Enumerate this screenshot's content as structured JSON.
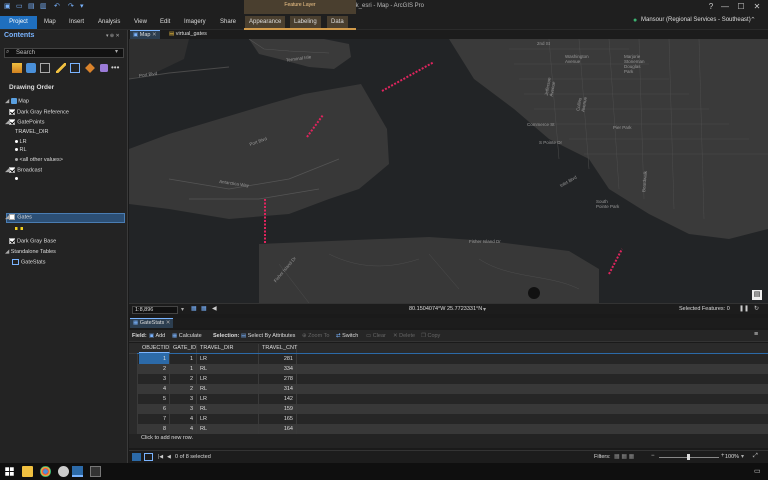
{
  "window": {
    "title": "spark_esri - Map - ArcGIS Pro",
    "help": "?",
    "minimize": "—",
    "maximize": "☐",
    "close": "✕"
  },
  "ribbon": {
    "tabs": [
      "Project",
      "Map",
      "Insert",
      "Analysis",
      "View",
      "Edit",
      "Imagery",
      "Share",
      "Appearance",
      "Labeling",
      "Data"
    ],
    "contextual_label": "Feature Layer",
    "user": "Mansour (Regional Services - Southeast)"
  },
  "contents": {
    "title": "Contents",
    "pin": "▾ ⊕ ✕",
    "search_placeholder": "Search",
    "drawing_order": "Drawing Order",
    "map": "Map",
    "dark_gray_reference": "Dark Gray Reference",
    "gate_points": "GatePoints",
    "travel_dir": "TRAVEL_DIR",
    "lr": "LR",
    "rl": "RL",
    "all_other": "<all other values>",
    "broadcast": "Broadcast",
    "gates": "Gates",
    "dark_gray_base": "Dark Gray Base",
    "standalone_tables": "Standalone Tables",
    "gatestats": "GateStats"
  },
  "map_tabs": {
    "map": "Map",
    "virtual_gates": "virtual_gates"
  },
  "map_labels": {
    "terminal_isle": "Terminal Isle",
    "port_blvd": "Port Blvd",
    "port_blvd2": "Port Blvd",
    "antarctica_way": "Antarctica Way",
    "second_st": "2nd St",
    "washington": "Washington\nAvenue",
    "jefferson": "Jefferson\nAvenue",
    "collins": "Collins\nAvenue",
    "commerce": "Commerce St",
    "s_pointe": "S Pointe Dr",
    "pier_park": "Pier Park",
    "south_pointe_park": "South\nPointe Park",
    "fisher_island": "Fisher Island Dr",
    "marjorie": "Marjorie\nStoneman\nDouglas\nPark",
    "inlet_blvd": "Inlet Blvd",
    "fisher_island_dr": "Fisher Island Dr",
    "boardwalk": "Boardwalk"
  },
  "map_status": {
    "scale": "1:8,896",
    "coords": "80.1504074°W 25.7723331°N",
    "selected": "Selected Features: 0"
  },
  "table": {
    "tab": "GateStats",
    "field_label": "Field:",
    "add": "Add",
    "calculate": "Calculate",
    "selection_label": "Selection:",
    "select_by_attr": "Select By Attributes",
    "zoom_to": "Zoom To",
    "switch": "Switch",
    "clear": "Clear",
    "delete": "Delete",
    "copy": "Copy",
    "columns": [
      "OBJECTID",
      "GATE_ID",
      "TRAVEL_DIR",
      "TRAVEL_CNT"
    ],
    "rows": [
      [
        "1",
        "1",
        "LR",
        "281"
      ],
      [
        "2",
        "1",
        "RL",
        "334"
      ],
      [
        "3",
        "2",
        "LR",
        "278"
      ],
      [
        "4",
        "2",
        "RL",
        "314"
      ],
      [
        "5",
        "3",
        "LR",
        "142"
      ],
      [
        "6",
        "3",
        "RL",
        "159"
      ],
      [
        "7",
        "4",
        "LR",
        "165"
      ],
      [
        "8",
        "4",
        "RL",
        "164"
      ]
    ],
    "add_row": "Click to add new row.",
    "selected_count": "0 of 8 selected",
    "filters": "Filters:",
    "zoom": "100%"
  },
  "colors": {
    "accent": "#1f6fbf",
    "gate": "#e0245e"
  }
}
